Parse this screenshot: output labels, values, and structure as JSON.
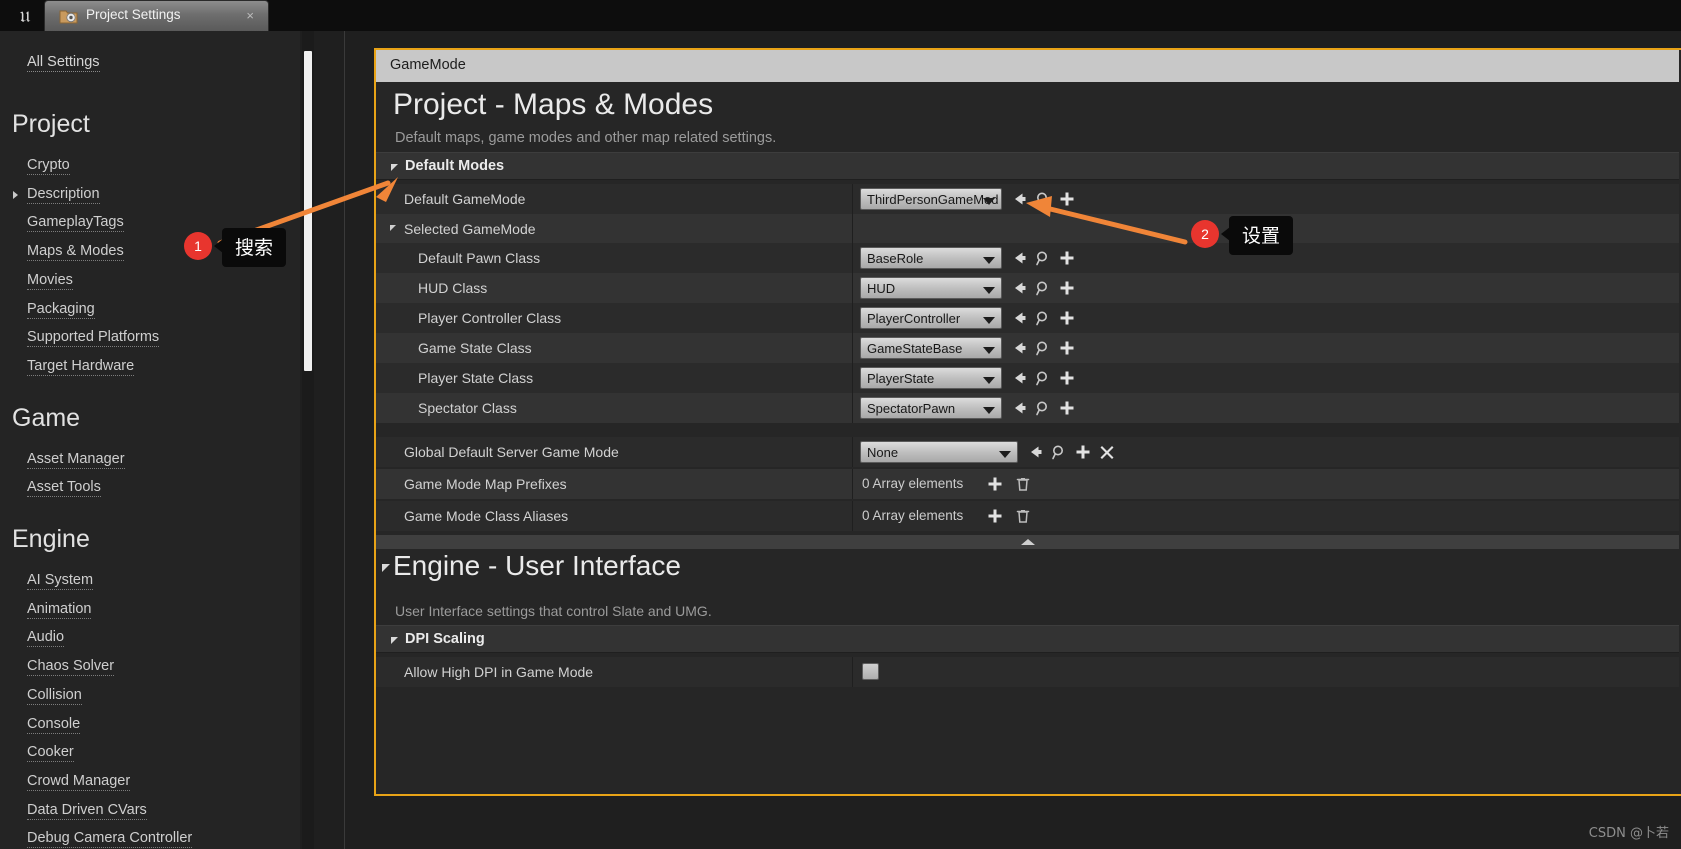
{
  "window": {
    "logo_icon": "unreal-engine-logo",
    "tab_icon": "project-settings-gear-folder-icon",
    "tab_title": "Project Settings",
    "close_label": "×"
  },
  "sidebar": {
    "all_settings_label": "All Settings",
    "groups": [
      {
        "heading": "Project",
        "items": [
          {
            "label": "Crypto",
            "expandable": false
          },
          {
            "label": "Description",
            "expandable": true
          },
          {
            "label": "GameplayTags",
            "expandable": false
          },
          {
            "label": "Maps & Modes",
            "expandable": false
          },
          {
            "label": "Movies",
            "expandable": false
          },
          {
            "label": "Packaging",
            "expandable": false
          },
          {
            "label": "Supported Platforms",
            "expandable": false
          },
          {
            "label": "Target Hardware",
            "expandable": false
          }
        ]
      },
      {
        "heading": "Game",
        "items": [
          {
            "label": "Asset Manager",
            "expandable": false
          },
          {
            "label": "Asset Tools",
            "expandable": false
          }
        ]
      },
      {
        "heading": "Engine",
        "items": [
          {
            "label": "AI System",
            "expandable": false
          },
          {
            "label": "Animation",
            "expandable": false
          },
          {
            "label": "Audio",
            "expandable": false
          },
          {
            "label": "Chaos Solver",
            "expandable": false
          },
          {
            "label": "Collision",
            "expandable": false
          },
          {
            "label": "Console",
            "expandable": false
          },
          {
            "label": "Cooker",
            "expandable": false
          },
          {
            "label": "Crowd Manager",
            "expandable": false
          },
          {
            "label": "Data Driven CVars",
            "expandable": false
          },
          {
            "label": "Debug Camera Controller",
            "expandable": false
          }
        ]
      }
    ]
  },
  "main": {
    "breadcrumb": "GameMode",
    "page_title": "Project - Maps & Modes",
    "page_subtitle": "Default maps, game modes and other map related settings.",
    "sections": [
      {
        "header": "Default Modes",
        "rows": [
          {
            "label": "Default GameMode",
            "indent": 1,
            "value": "ThirdPersonGameMod",
            "control": "combo",
            "combo_width": 142,
            "icons": [
              "reset-arrow-icon",
              "browse-magnifier-icon",
              "new-asset-plus-icon"
            ]
          },
          {
            "label": "Selected GameMode",
            "indent": 1,
            "control": "expander",
            "expandable": true
          },
          {
            "label": "Default Pawn Class",
            "indent": 2,
            "value": "BaseRole",
            "control": "combo",
            "combo_width": 142,
            "icons": [
              "reset-arrow-icon",
              "browse-magnifier-icon",
              "new-asset-plus-icon"
            ]
          },
          {
            "label": "HUD Class",
            "indent": 2,
            "value": "HUD",
            "control": "combo",
            "combo_width": 142,
            "icons": [
              "reset-arrow-icon",
              "browse-magnifier-icon",
              "new-asset-plus-icon"
            ]
          },
          {
            "label": "Player Controller Class",
            "indent": 2,
            "value": "PlayerController",
            "control": "combo",
            "combo_width": 142,
            "icons": [
              "reset-arrow-icon",
              "browse-magnifier-icon",
              "new-asset-plus-icon"
            ]
          },
          {
            "label": "Game State Class",
            "indent": 2,
            "value": "GameStateBase",
            "control": "combo",
            "combo_width": 142,
            "icons": [
              "reset-arrow-icon",
              "browse-magnifier-icon",
              "new-asset-plus-icon"
            ]
          },
          {
            "label": "Player State Class",
            "indent": 2,
            "value": "PlayerState",
            "control": "combo",
            "combo_width": 142,
            "icons": [
              "reset-arrow-icon",
              "browse-magnifier-icon",
              "new-asset-plus-icon"
            ]
          },
          {
            "label": "Spectator Class",
            "indent": 2,
            "value": "SpectatorPawn",
            "control": "combo",
            "combo_width": 142,
            "icons": [
              "reset-arrow-icon",
              "browse-magnifier-icon",
              "new-asset-plus-icon"
            ]
          },
          {
            "label": "Global Default Server Game Mode",
            "indent": 1,
            "value": "None",
            "control": "combo",
            "combo_width": 158,
            "icons": [
              "reset-arrow-icon",
              "browse-magnifier-icon",
              "new-asset-plus-icon",
              "clear-x-icon"
            ]
          },
          {
            "label": "Game Mode Map Prefixes",
            "indent": 1,
            "value": "0 Array elements",
            "control": "array",
            "icons": [
              "add-element-plus-icon",
              "delete-trash-icon"
            ]
          },
          {
            "label": "Game Mode Class Aliases",
            "indent": 1,
            "value": "0 Array elements",
            "control": "array",
            "icons": [
              "add-element-plus-icon",
              "delete-trash-icon"
            ]
          }
        ]
      }
    ],
    "engine_section": {
      "title": "Engine - User Interface",
      "subtitle": "User Interface settings that control Slate and UMG.",
      "group_header": "DPI Scaling",
      "rows": [
        {
          "label": "Allow High DPI in Game Mode",
          "control": "checkbox",
          "checked": false
        }
      ]
    }
  },
  "annotations": [
    {
      "number": "1",
      "text": "搜索"
    },
    {
      "number": "2",
      "text": "设置"
    }
  ],
  "watermark": "CSDN @卜若",
  "colors": {
    "accent_orange": "#e8a317",
    "annotation_red": "#e8352e",
    "arrow_orange": "#f08538",
    "panel_bg": "#262626",
    "sidebar_bg": "#242424"
  }
}
